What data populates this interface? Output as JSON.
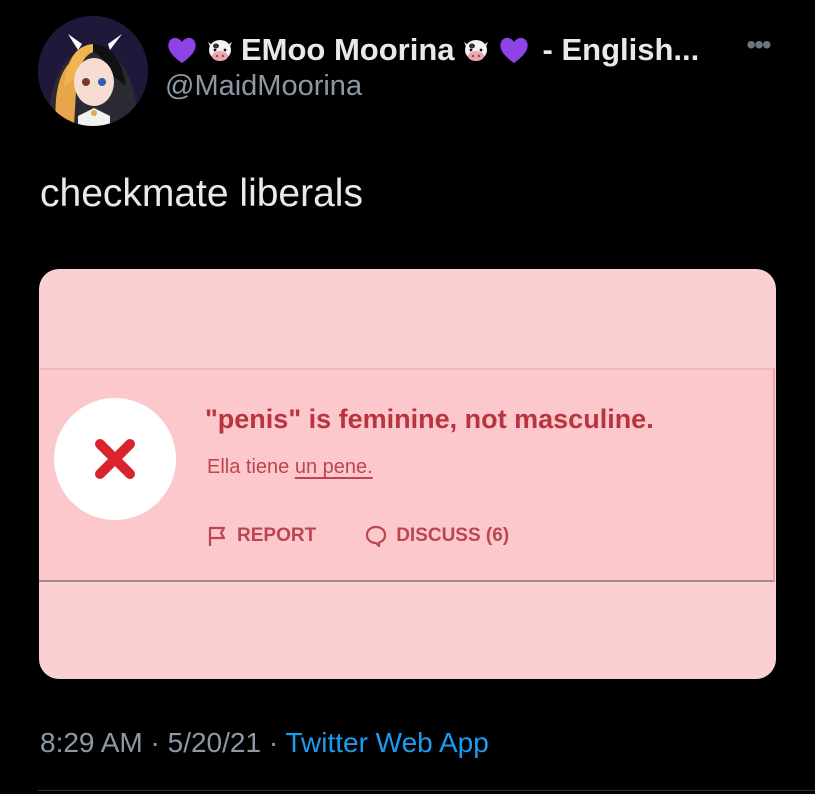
{
  "author": {
    "display_name_prefix_emoji": "purple-heart-icon",
    "display_name": "EMoo Moorina",
    "display_name_suffix": "- English...",
    "handle": "@MaidMoorina"
  },
  "tweet": {
    "text": "checkmate liberals"
  },
  "embedded_image": {
    "title": "\"penis\" is feminine, not masculine.",
    "example_prefix": "Ella tiene ",
    "example_underlined": "un pene.",
    "report_label": "REPORT",
    "discuss_label": "DISCUSS (6)"
  },
  "meta": {
    "time": "8:29 AM",
    "sep1": " · ",
    "date": "5/20/21",
    "sep2": " · ",
    "source": "Twitter Web App"
  },
  "more_label": "•••",
  "colors": {
    "background": "#000000",
    "card_pink": "#fbd0d3",
    "error_red": "#b8343f",
    "link_blue": "#1d9bf0",
    "purple_heart": "#8e43e6"
  }
}
